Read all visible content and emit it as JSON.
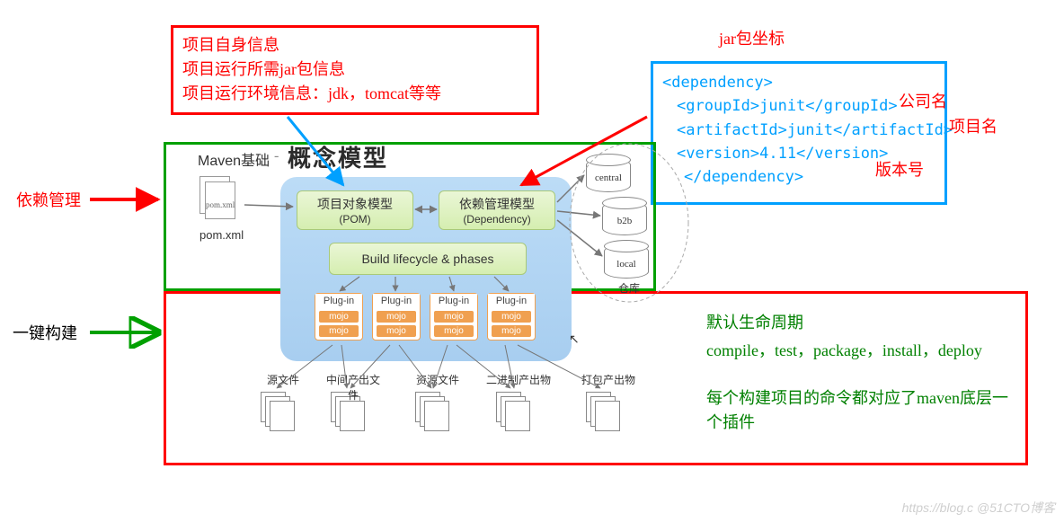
{
  "annotations": {
    "top_red_box": {
      "line1": "项目自身信息",
      "line2": "项目运行所需jar包信息",
      "line3": "项目运行环境信息：jdk，tomcat等等"
    },
    "jar_title": "jar包坐标",
    "xml": {
      "dep_open": "<dependency>",
      "groupId": "<groupId>junit</groupId>",
      "artifactId": "<artifactId>junit</artifactId>",
      "version": "<version>4.11</version>",
      "dep_close": "</dependency>",
      "label_company": "公司名",
      "label_project": "项目名",
      "label_version": "版本号"
    },
    "left_label_dep": "依赖管理",
    "left_label_build": "一键构建",
    "lifecycle": {
      "line1": "默认生命周期",
      "line2": "compile，test，package，install，deploy",
      "line3": "每个构建项目的命令都对应了maven底层一个插件"
    }
  },
  "diagram": {
    "title_left": "Maven基础",
    "title_right": "概念模型",
    "pom_file": "pom.xml",
    "pom_inside": "pom.xml",
    "box_pom": {
      "l1": "项目对象模型",
      "l2": "(POM)"
    },
    "box_dep": {
      "l1": "依赖管理模型",
      "l2": "(Dependency)"
    },
    "box_life": "Build lifecycle & phases",
    "plugin_label": "Plug-in",
    "mojo_label": "mojo",
    "repo_central": "central",
    "repo_b2b": "b2b",
    "repo_local": "local",
    "repo_group": "仓库",
    "outputs": [
      "源文件",
      "中间产出文件",
      "资源文件",
      "二进制产出物",
      "打包产出物"
    ]
  },
  "watermark": "https://blog.c  @51CTO博客"
}
